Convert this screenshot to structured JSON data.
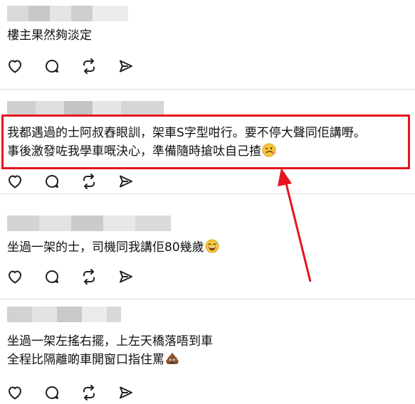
{
  "posts": [
    {
      "lines": [
        "樓主果然夠淡定"
      ]
    },
    {
      "lines": [
        "我都遇過的士阿叔舂眼訓，架車S字型咁行。要不停大聲同佢講嘢。",
        "事後激發咗我學車嘅決心，準備隨時搶呔自己揸"
      ]
    },
    {
      "lines": [
        "坐過一架的士，司機同我講佢80幾歲"
      ]
    },
    {
      "lines": [
        "坐過一架左搖右擺，上左天橋落唔到車",
        "全程比隔離啲車開窗口指住罵"
      ]
    }
  ],
  "icons": {
    "like": "heart-icon",
    "comment": "comment-bubble-icon",
    "repost": "repost-icon",
    "share": "send-icon"
  },
  "emoji": [
    "woozy-face-emoji",
    "grinning-sweat-emoji",
    "pile-of-poo-emoji"
  ],
  "colors": {
    "highlight": "#e8131f",
    "divider": "#dcdcdc",
    "text": "#111111"
  }
}
